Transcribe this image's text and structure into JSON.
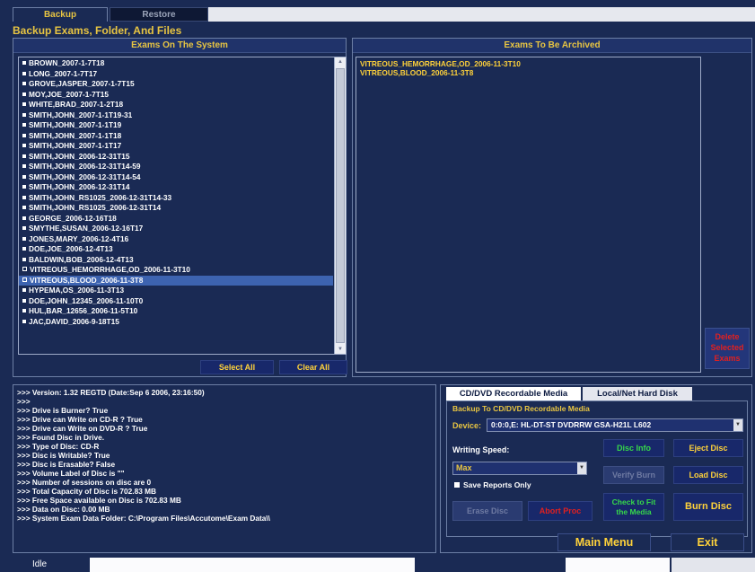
{
  "tabs": {
    "backup": "Backup",
    "restore": "Restore"
  },
  "section_title": "Backup Exams, Folder, And Files",
  "exams_panel": {
    "title": "Exams On The System",
    "items": [
      {
        "label": "BROWN_2007-1-7T18",
        "state": "normal"
      },
      {
        "label": "LONG_2007-1-7T17",
        "state": "normal"
      },
      {
        "label": "GROVE,JASPER_2007-1-7T15",
        "state": "normal"
      },
      {
        "label": "MOY,JOE_2007-1-7T15",
        "state": "normal"
      },
      {
        "label": "WHITE,BRAD_2007-1-2T18",
        "state": "normal"
      },
      {
        "label": "SMITH,JOHN_2007-1-1T19-31",
        "state": "normal"
      },
      {
        "label": "SMITH,JOHN_2007-1-1T19",
        "state": "normal"
      },
      {
        "label": "SMITH,JOHN_2007-1-1T18",
        "state": "normal"
      },
      {
        "label": "SMITH,JOHN_2007-1-1T17",
        "state": "normal"
      },
      {
        "label": "SMITH,JOHN_2006-12-31T15",
        "state": "normal"
      },
      {
        "label": "SMITH,JOHN_2006-12-31T14-59",
        "state": "normal"
      },
      {
        "label": "SMITH,JOHN_2006-12-31T14-54",
        "state": "normal"
      },
      {
        "label": "SMITH,JOHN_2006-12-31T14",
        "state": "normal"
      },
      {
        "label": "SMITH,JOHN_RS1025_2006-12-31T14-33",
        "state": "normal"
      },
      {
        "label": "SMITH,JOHN_RS1025_2006-12-31T14",
        "state": "normal"
      },
      {
        "label": "GEORGE_2006-12-16T18",
        "state": "normal"
      },
      {
        "label": "SMYTHE,SUSAN_2006-12-16T17",
        "state": "normal"
      },
      {
        "label": "JONES,MARY_2006-12-4T16",
        "state": "normal"
      },
      {
        "label": "DOE,JOE_2006-12-4T13",
        "state": "normal"
      },
      {
        "label": "BALDWIN,BOB_2006-12-4T13",
        "state": "normal"
      },
      {
        "label": "VITREOUS_HEMORRHAGE,OD_2006-11-3T10",
        "state": "checked"
      },
      {
        "label": "VITREOUS,BLOOD_2006-11-3T8",
        "state": "selected"
      },
      {
        "label": "HYPEMA,OS_2006-11-3T13",
        "state": "normal"
      },
      {
        "label": "DOE,JOHN_12345_2006-11-10T0",
        "state": "normal"
      },
      {
        "label": "HUL,BAR_12656_2006-11-5T10",
        "state": "normal"
      },
      {
        "label": "JAC,DAVID_2006-9-18T15",
        "state": "normal"
      }
    ],
    "select_all": "Select All",
    "clear_all": "Clear All"
  },
  "archive_panel": {
    "title": "Exams To Be Archived",
    "items": [
      "VITREOUS_HEMORRHAGE,OD_2006-11-3T10",
      "VITREOUS,BLOOD_2006-11-3T8"
    ],
    "delete_button": [
      "Delete",
      "Selected",
      "Exams"
    ]
  },
  "log": [
    ">>> Version: 1.32 REGTD (Date:Sep  6 2006, 23:16:50)",
    ">>>",
    ">>> Drive is Burner? True",
    ">>> Drive can Write on CD-R ? True",
    ">>> Drive can Write on DVD-R ? True",
    ">>> Found Disc in Drive.",
    ">>> Type of Disc: CD-R",
    ">>> Disc is Writable? True",
    ">>> Disc is Erasable? False",
    ">>> Volume Label of Disc is \"\"",
    ">>> Number of sessions on disc are 0",
    ">>> Total Capacity of Disc is 702.83 MB",
    ">>> Free Space available on Disc is 702.83 MB",
    ">>> Data on Disc: 0.00 MB",
    ">>> System Exam Data Folder: C:\\Program Files\\Accutome\\Exam Data\\\\"
  ],
  "media": {
    "tab_cd": "CD/DVD  Recordable Media",
    "tab_hd": "Local/Net Hard Disk",
    "group_title": "Backup To CD/DVD Recordable Media",
    "device_label": "Device:",
    "device_value": "0:0:0,E: HL-DT-ST DVDRRW GSA-H21L  L602",
    "speed_label": "Writing Speed:",
    "speed_value": "Max",
    "save_reports": "Save Reports Only",
    "disc_info": "Disc Info",
    "eject_disc": "Eject Disc",
    "verify_burn": "Verify Burn",
    "load_disc": "Load Disc",
    "check_fit": [
      "Check to Fit",
      "the Media"
    ],
    "erase_disc": "Erase Disc",
    "abort_proc": "Abort Proc",
    "burn_disc": "Burn Disc"
  },
  "footer": {
    "main_menu": "Main Menu",
    "exit": "Exit"
  },
  "status": {
    "text": "Idle"
  },
  "colors": {
    "background": "#1a2a54",
    "accent_yellow": "#ffd23a",
    "red": "#e02020",
    "green": "#36d84a",
    "selection": "#3d63b0"
  }
}
